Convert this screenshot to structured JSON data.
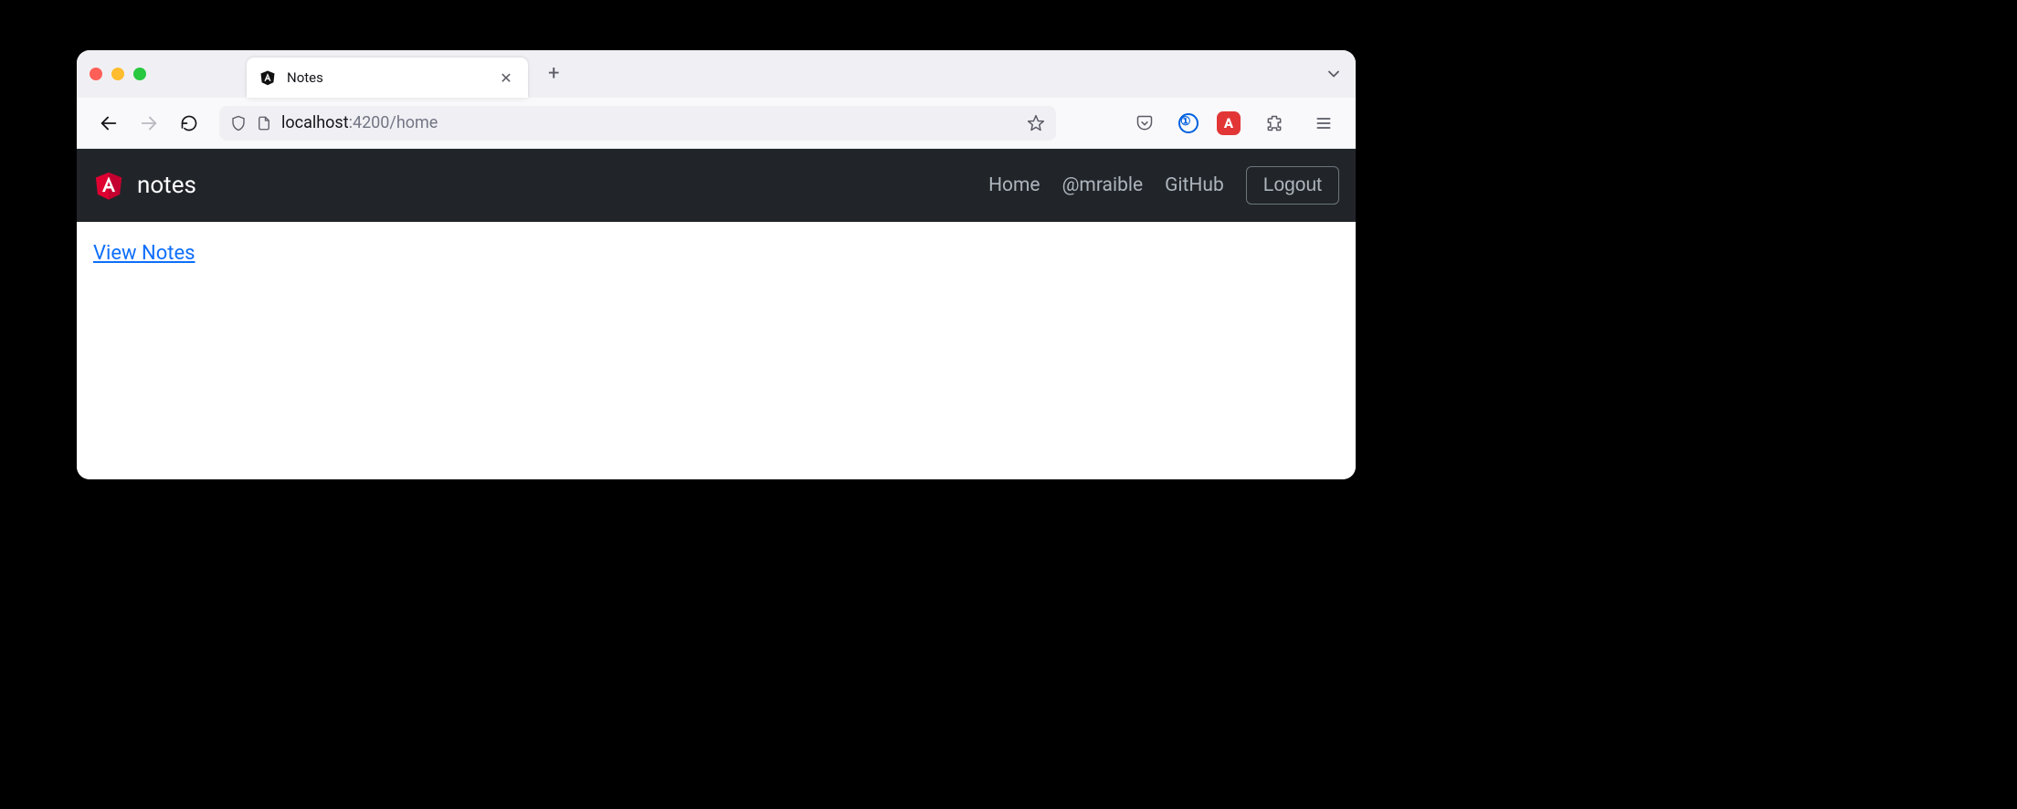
{
  "browser": {
    "tab": {
      "title": "Notes"
    },
    "address": {
      "host": "localhost",
      "path": ":4200/home"
    }
  },
  "navbar": {
    "brand": "notes",
    "links": {
      "home": "Home",
      "profile": "@mraible",
      "github": "GitHub"
    },
    "logout": "Logout"
  },
  "content": {
    "view_notes": "View Notes"
  }
}
